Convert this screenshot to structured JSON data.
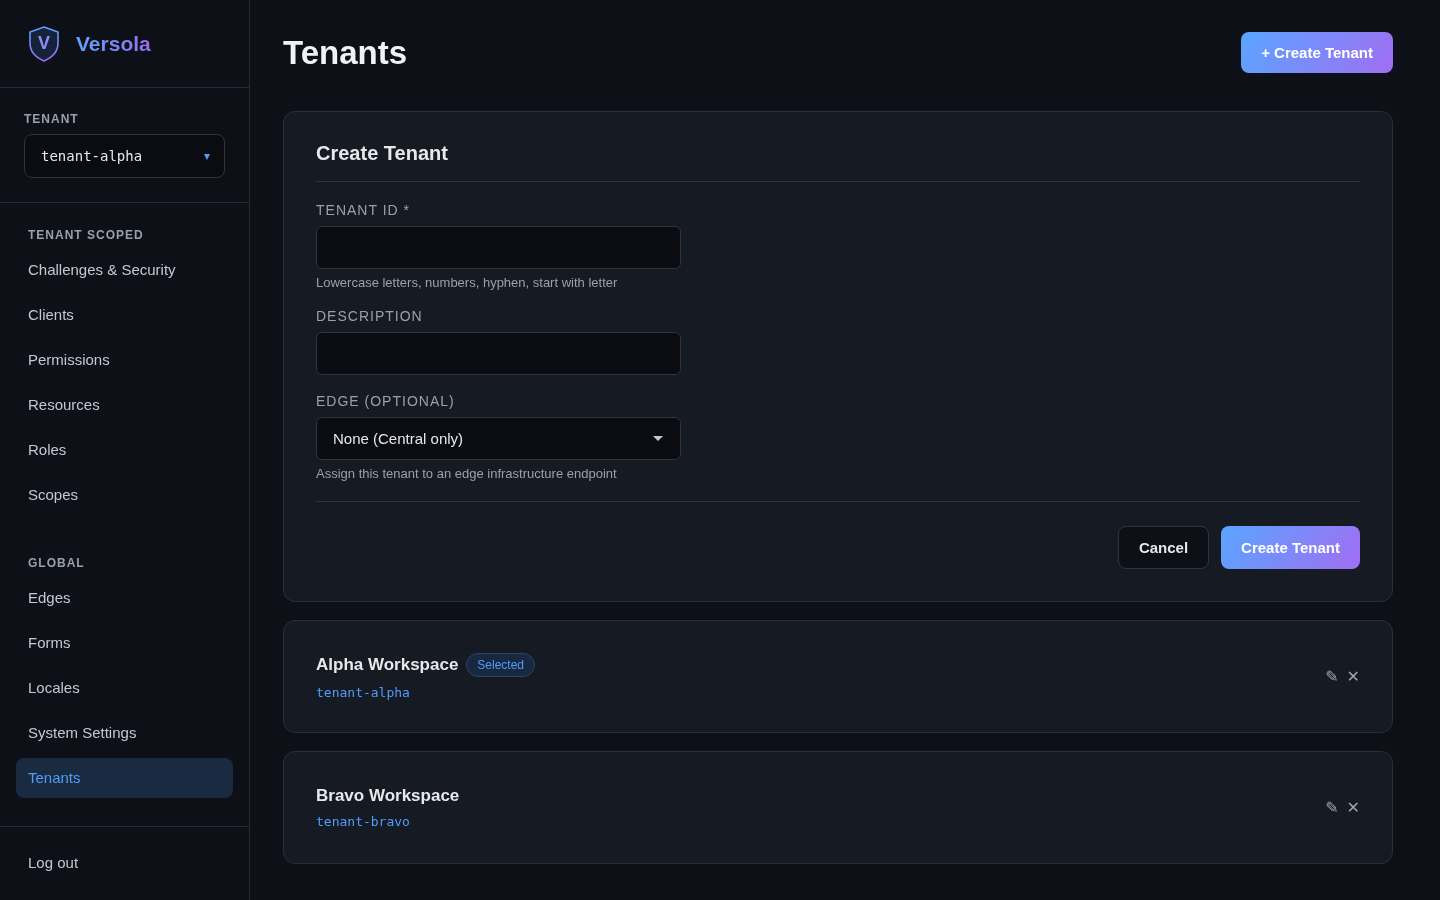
{
  "brand": {
    "logo_letter": "V",
    "name": "Versola"
  },
  "tenant_picker": {
    "label": "TENANT",
    "value": "tenant-alpha",
    "caret": "▾"
  },
  "nav_sections": [
    {
      "title": "TENANT SCOPED",
      "items": [
        {
          "label": "Challenges & Security",
          "selected": false
        },
        {
          "label": "Clients",
          "selected": false
        },
        {
          "label": "Permissions",
          "selected": false
        },
        {
          "label": "Resources",
          "selected": false
        },
        {
          "label": "Roles",
          "selected": false
        },
        {
          "label": "Scopes",
          "selected": false
        }
      ]
    },
    {
      "title": "GLOBAL",
      "items": [
        {
          "label": "Edges",
          "selected": false
        },
        {
          "label": "Forms",
          "selected": false
        },
        {
          "label": "Locales",
          "selected": false
        },
        {
          "label": "System Settings",
          "selected": false
        },
        {
          "label": "Tenants",
          "selected": true
        }
      ]
    }
  ],
  "logout": "Log out",
  "page_title": "Tenants",
  "header_button": "+ Create Tenant",
  "form": {
    "title": "Create Tenant",
    "fields": [
      {
        "kind": "text",
        "label": "TENANT ID *",
        "hint": "Lowercase letters, numbers, hyphen, start with letter"
      },
      {
        "kind": "text",
        "label": "DESCRIPTION"
      },
      {
        "kind": "select",
        "label": "EDGE (OPTIONAL)",
        "value": "None (Central only)",
        "hint": "Assign this tenant to an edge infrastructure endpoint"
      }
    ],
    "cancel": "Cancel",
    "submit": "Create Tenant"
  },
  "tenants": [
    {
      "name": "Alpha Workspace",
      "id": "tenant-alpha",
      "selected": true,
      "badge": "Selected",
      "edit": "✎",
      "delete": "✕"
    },
    {
      "name": "Bravo Workspace",
      "id": "tenant-bravo",
      "selected": false,
      "edit": "✎",
      "delete": "✕"
    }
  ]
}
